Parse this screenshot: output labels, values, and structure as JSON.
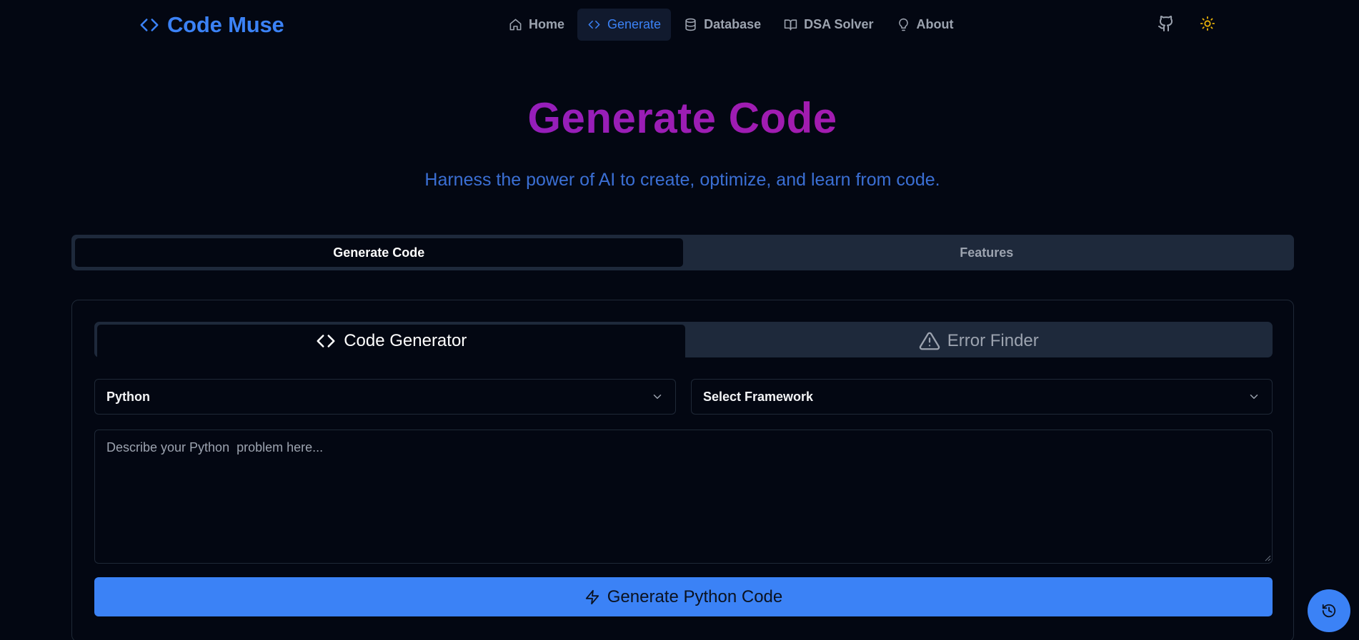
{
  "brand": {
    "name": "Code Muse",
    "icon": "code-brackets-icon",
    "color": "#3b82f6"
  },
  "nav": {
    "items": [
      {
        "label": "Home",
        "icon": "home-icon",
        "active": false
      },
      {
        "label": "Generate",
        "icon": "code-brackets-icon",
        "active": true
      },
      {
        "label": "Database",
        "icon": "database-icon",
        "active": false
      },
      {
        "label": "DSA Solver",
        "icon": "book-open-icon",
        "active": false
      },
      {
        "label": "About",
        "icon": "lightbulb-icon",
        "active": false
      }
    ],
    "github_icon": "github-icon",
    "theme_icon": "sun-icon",
    "theme_icon_color": "#eab308"
  },
  "hero": {
    "title": "Generate Code",
    "subtitle": "Harness the power of AI to create, optimize, and learn from code."
  },
  "outer_tabs": [
    {
      "label": "Generate Code",
      "active": true
    },
    {
      "label": "Features",
      "active": false
    }
  ],
  "inner_tabs": [
    {
      "label": "Code Generator",
      "icon": "code-brackets-icon",
      "active": true
    },
    {
      "label": "Error Finder",
      "icon": "warning-triangle-icon",
      "active": false
    }
  ],
  "form": {
    "language_select": {
      "value": "Python"
    },
    "framework_select": {
      "value": "Select Framework"
    },
    "prompt": {
      "placeholder": "Describe your Python  problem here...",
      "value": ""
    },
    "generate_button": {
      "label": "Generate Python Code",
      "icon": "zap-icon"
    }
  },
  "history_button": {
    "icon": "history-icon"
  },
  "colors": {
    "background": "#030712",
    "accent": "#3b82f6",
    "title_gradient": [
      "#7e22ce",
      "#c026d3"
    ],
    "tab_track": "#1e293b"
  }
}
